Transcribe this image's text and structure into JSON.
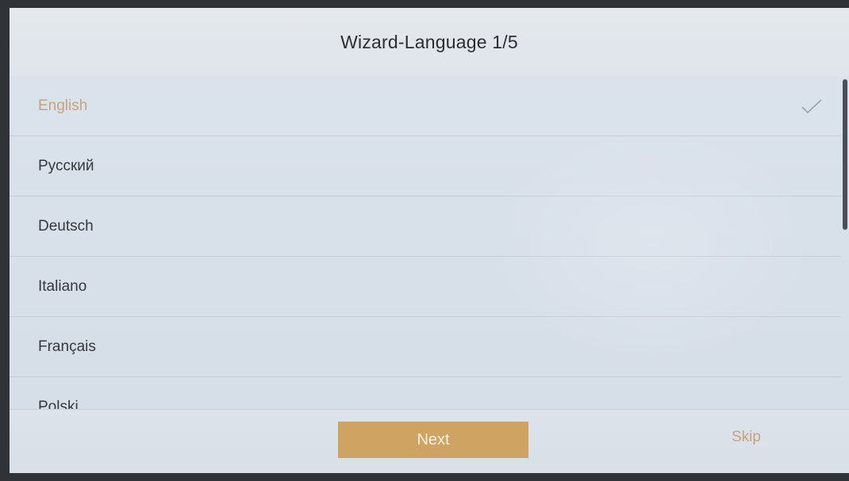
{
  "title": "Wizard-Language 1/5",
  "languages": [
    {
      "label": "English",
      "selected": true
    },
    {
      "label": "Русский",
      "selected": false
    },
    {
      "label": "Deutsch",
      "selected": false
    },
    {
      "label": "Italiano",
      "selected": false
    },
    {
      "label": "Français",
      "selected": false
    },
    {
      "label": "Polski",
      "selected": false
    }
  ],
  "footer": {
    "next_label": "Next",
    "skip_label": "Skip"
  },
  "colors": {
    "accent": "#cfa463",
    "selected_text": "#c7a47a"
  },
  "icons": {
    "selected_marker": "check-icon"
  }
}
